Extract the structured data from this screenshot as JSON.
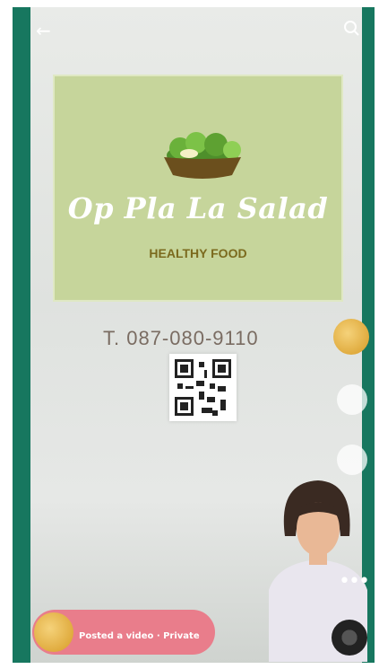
{
  "card": {
    "brand_name": "Op Pla La Salad",
    "tagline": "HEALTHY FOOD"
  },
  "contact": {
    "phone": "T. 087-080-9110"
  },
  "notification": {
    "subtitle": "",
    "text": "Posted a video · Private"
  },
  "icons": [
    "back-arrow-icon",
    "search-icon",
    "salad-bowl-icon",
    "qr-code",
    "heart-icon",
    "comment-icon",
    "more-icon",
    "music-disc-icon"
  ],
  "colors": {
    "side_bar": "#17775f",
    "card_bg": "#c6d59b",
    "tagline": "#7b6a1e",
    "notice_bg": "#e97d8b"
  }
}
